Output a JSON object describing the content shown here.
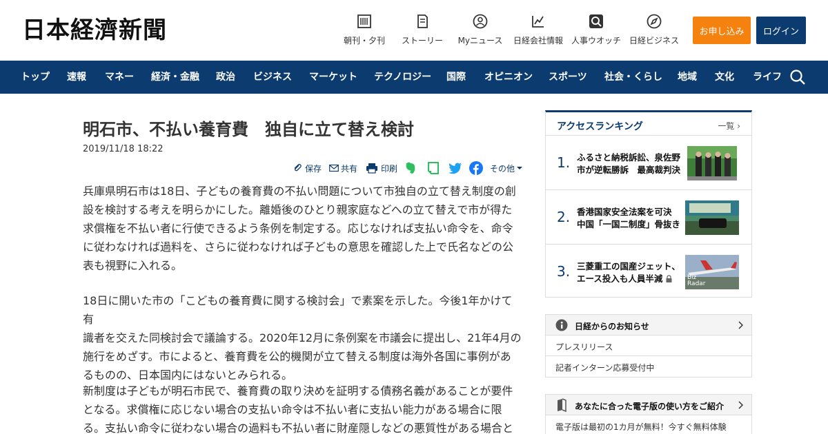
{
  "header": {
    "logo": "日本経濟新聞",
    "nav_items": [
      {
        "label": "朝刊・夕刊",
        "icon": "newspaper-icon"
      },
      {
        "label": "ストーリー",
        "icon": "story-icon"
      },
      {
        "label": "Myニュース",
        "icon": "user-icon"
      },
      {
        "label": "日経会社情報",
        "icon": "chart-icon"
      },
      {
        "label": "人事ウオッチ",
        "icon": "search-person-icon"
      },
      {
        "label": "日経ビジネス",
        "icon": "compass-icon"
      }
    ],
    "apply_label": "お申し込み",
    "login_label": "ログイン"
  },
  "navbar": {
    "items": [
      "トップ",
      "速報",
      "マネー",
      "経済・金融",
      "政治",
      "ビジネス",
      "マーケット",
      "テクノロジー",
      "国際",
      "オピニオン",
      "スポーツ",
      "社会・くらし",
      "地域",
      "文化",
      "ライフ"
    ],
    "search_icon": "search-icon"
  },
  "article": {
    "title": "明石市、不払い養育費　独自に立て替え検討",
    "date": "2019/11/18 18:22",
    "tools": {
      "save": "保存",
      "share": "共有",
      "print": "印刷",
      "more": "その他"
    },
    "paragraphs": [
      [
        "兵庫県明石市は18日、子どもの養育費の不払い問題について市独自の立て替え制度の創",
        "設を検討する考えを明らかにした。離婚後のひとり親家庭などへの立て替えで市が得た",
        "求償権を不払い者に行使できるよう条例を制定する。応じなければ支払い命令を、命令",
        "に従わなければ過料を、さらに従わなければ子どもの意思を確認した上で氏名などの公",
        "表も視野に入れる。"
      ],
      [
        "18日に開いた市の「こどもの養育費に関する検討会」で素案を示した。今後1年かけて有",
        "識者を交えた同検討会で議論する。2020年12月に条例案を市議会に提出し、21年4月の",
        "施行をめざす。市によると、養育費を公的機関が立て替える制度は海外各国に事例があ",
        "るものの、日本国内にはないとみられる。"
      ],
      [
        "新制度は子どもが明石市民で、養育費の取り決めを証明する債務名義があることが要件",
        "となる。求償権に応じない場合の支払い命令は不払い者に支払い能力がある場合に限",
        "る。支払い命令に従わない場合の過料も不払い者に財産隠しなどの悪質性がある場合と"
      ]
    ]
  },
  "ranking": {
    "title": "アクセスランキング",
    "all_label": "一覧",
    "items": [
      {
        "rank": "1.",
        "lines": [
          "ふるさと納税訴訟、泉佐野",
          "市が逆転勝訴　最高裁判決"
        ],
        "locked": false
      },
      {
        "rank": "2.",
        "lines": [
          "香港国家安全法案を可決",
          "中国「一国二制度」骨抜き"
        ],
        "locked": false
      },
      {
        "rank": "3.",
        "lines": [
          "三菱重工の国産ジェット、",
          "エース投入も人員半減"
        ],
        "locked": true,
        "img_overlay": [
          "Biz",
          "Radar"
        ]
      }
    ]
  },
  "notices": {
    "title": "日経からのお知らせ",
    "items": [
      "プレスリリース",
      "記者インターン応募受付中"
    ]
  },
  "guide": {
    "title": "あなたに合った電子版の使い方をご紹介",
    "items": [
      "電子版は最初の1カ月が無料！今すぐ無料体験"
    ]
  },
  "colors": {
    "brand_navy": "#0c3b6f",
    "accent_orange": "#f5820f",
    "evernote_green": "#2dbe60",
    "twitter_blue": "#1da1f2",
    "facebook_blue": "#1877f2"
  }
}
